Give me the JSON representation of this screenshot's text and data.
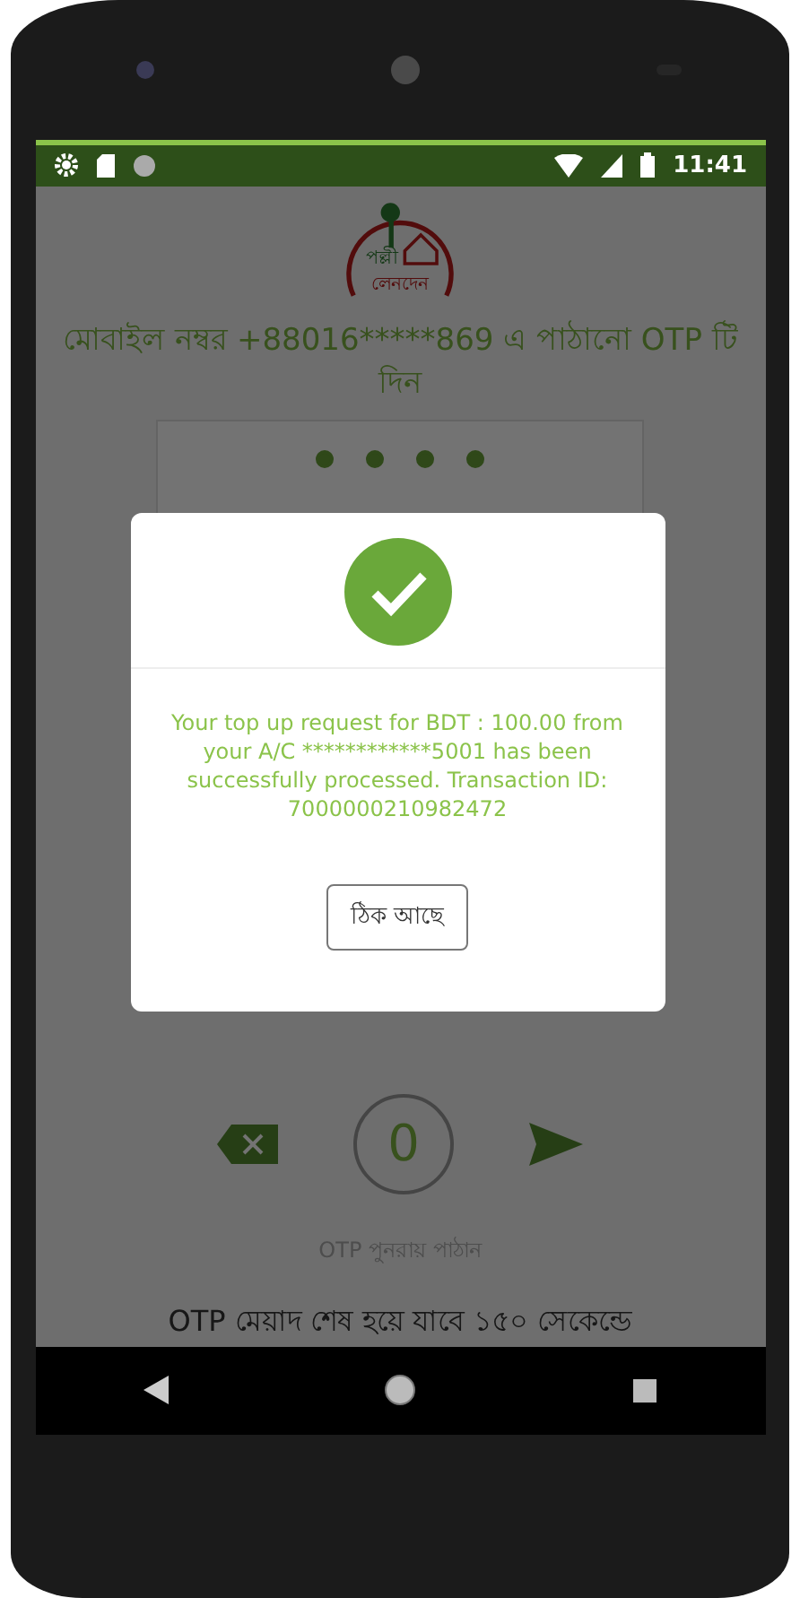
{
  "status_bar": {
    "time": "11:41"
  },
  "logo": {
    "title": "পল্লী",
    "subtitle": "লেনদেন"
  },
  "instruction": "মোবাইল নম্বর +88016*****869 এ পাঠানো OTP টি দিন",
  "pin_dots": [
    {
      "filled": true
    },
    {
      "filled": true
    },
    {
      "filled": true
    },
    {
      "filled": true
    }
  ],
  "keypad": {
    "digit": "0"
  },
  "resend_link": "OTP পুনরায় পাঠান",
  "expiry_text": "OTP মেয়াদ শেষ হয়ে যাবে ১৫০ সেকেন্ডে",
  "dialog": {
    "message": "Your top up request for BDT : 100.00 from your  A/C ************5001 has been successfully processed. Transaction ID: 7000000210982472",
    "button": "ঠিক আছে"
  }
}
